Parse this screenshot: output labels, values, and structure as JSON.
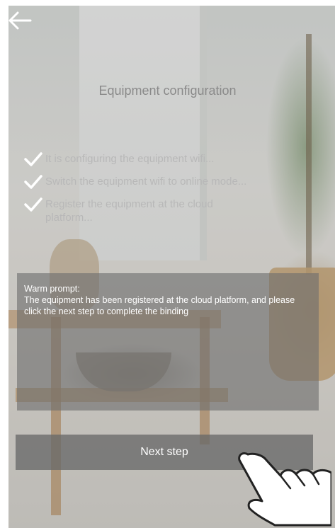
{
  "header": {
    "back_icon": "arrow-left-icon",
    "title": "Equipment configuration"
  },
  "steps": [
    {
      "icon": "check-icon",
      "label": "It is configuring the equipment wifi..."
    },
    {
      "icon": "check-icon",
      "label": "Switch the equipment wifi to online mode..."
    },
    {
      "icon": "check-icon",
      "label": "Register the equipment at the cloud platform..."
    }
  ],
  "prompt": {
    "title": "Warm prompt:",
    "body": "The equipment has been registered at the cloud platform, and please click the next step to complete the binding"
  },
  "footer": {
    "next_label": "Next step",
    "pointer_icon": "hand-pointer-icon"
  },
  "colors": {
    "overlay_panel": "#6e6e6e",
    "button_bg": "#696969",
    "text_light": "#ffffff",
    "title_text": "#8a8a8a"
  }
}
